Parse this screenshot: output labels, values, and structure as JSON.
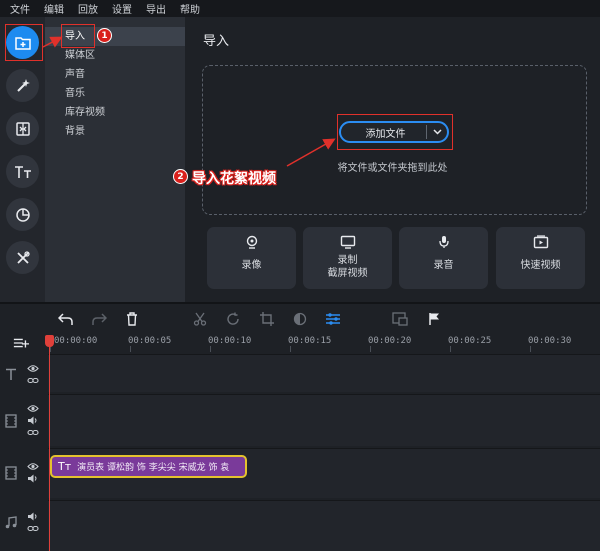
{
  "menu": [
    "文件",
    "编辑",
    "回放",
    "设置",
    "导出",
    "帮助"
  ],
  "sidebar": {
    "items": [
      "导入",
      "媒体区",
      "声音",
      "音乐",
      "库存视频",
      "背景"
    ]
  },
  "main": {
    "title": "导入",
    "add_button": "添加文件",
    "drop_hint": "将文件或文件夹拖到此处",
    "actions": [
      {
        "label": "录像",
        "icon": "webcam-icon"
      },
      {
        "label": "录制\n截屏视频",
        "icon": "screen-record-icon"
      },
      {
        "label": "录音",
        "icon": "microphone-icon"
      },
      {
        "label": "快速视频",
        "icon": "quick-video-icon"
      }
    ]
  },
  "annotations": {
    "badge1": "1",
    "badge2": "2",
    "label2": "导入花絮视频",
    "color": "#e0312b"
  },
  "timeline": {
    "ticks": [
      "00:00:00",
      "00:00:05",
      "00:00:10",
      "00:00:15",
      "00:00:20",
      "00:00:25",
      "00:00:30"
    ],
    "title_clip_text": "演员表 谭松韵 饰 李尖尖 宋威龙 饰 袁"
  },
  "colors": {
    "accent": "#1d8bf0",
    "playhead": "#e0403a",
    "clip": "#7a3a9a",
    "clip_border": "#e4c22e"
  }
}
